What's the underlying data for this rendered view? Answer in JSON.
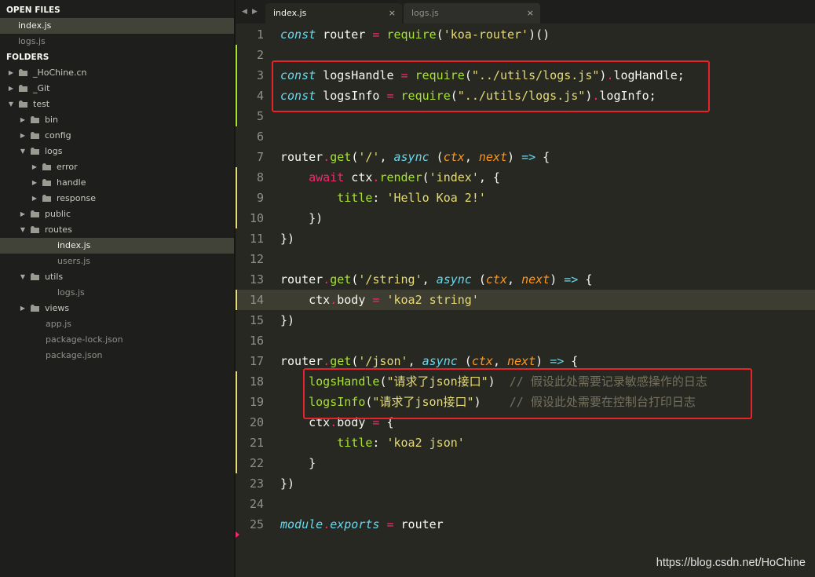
{
  "sidebar": {
    "open_files_header": "OPEN FILES",
    "open_files": [
      {
        "name": "index.js",
        "active": true
      },
      {
        "name": "logs.js",
        "active": false
      }
    ],
    "folders_header": "FOLDERS",
    "tree": [
      {
        "name": "_HoChine.cn",
        "type": "folder",
        "expanded": false,
        "depth": 0
      },
      {
        "name": "_Git",
        "type": "folder",
        "expanded": false,
        "depth": 0
      },
      {
        "name": "test",
        "type": "folder",
        "expanded": true,
        "depth": 0
      },
      {
        "name": "bin",
        "type": "folder",
        "expanded": false,
        "depth": 1
      },
      {
        "name": "config",
        "type": "folder",
        "expanded": false,
        "depth": 1
      },
      {
        "name": "logs",
        "type": "folder",
        "expanded": true,
        "depth": 1
      },
      {
        "name": "error",
        "type": "folder",
        "expanded": false,
        "depth": 2
      },
      {
        "name": "handle",
        "type": "folder",
        "expanded": false,
        "depth": 2
      },
      {
        "name": "response",
        "type": "folder",
        "expanded": false,
        "depth": 2
      },
      {
        "name": "public",
        "type": "folder",
        "expanded": false,
        "depth": 1
      },
      {
        "name": "routes",
        "type": "folder",
        "expanded": true,
        "depth": 1
      },
      {
        "name": "index.js",
        "type": "file",
        "active": true,
        "depth": 2
      },
      {
        "name": "users.js",
        "type": "file",
        "depth": 2
      },
      {
        "name": "utils",
        "type": "folder",
        "expanded": true,
        "depth": 1
      },
      {
        "name": "logs.js",
        "type": "file",
        "depth": 2
      },
      {
        "name": "views",
        "type": "folder",
        "expanded": false,
        "depth": 1
      },
      {
        "name": "app.js",
        "type": "file",
        "depth": 1
      },
      {
        "name": "package-lock.json",
        "type": "file",
        "depth": 1
      },
      {
        "name": "package.json",
        "type": "file",
        "depth": 1
      }
    ]
  },
  "tabs": [
    {
      "label": "index.js",
      "active": true,
      "close": "×"
    },
    {
      "label": "logs.js",
      "active": false,
      "close": "×"
    }
  ],
  "nav_arrows": {
    "left": "◀",
    "right": "▶"
  },
  "editor": {
    "current_line": 14,
    "lines": [
      {
        "n": "1",
        "mark": "",
        "tokens": [
          [
            "kw",
            "const"
          ],
          [
            "pl",
            " router "
          ],
          [
            "op",
            "="
          ],
          [
            "pl",
            " "
          ],
          [
            "fn",
            "require"
          ],
          [
            "pl",
            "("
          ],
          [
            "str",
            "'koa-router'"
          ],
          [
            "pl",
            ")()"
          ]
        ]
      },
      {
        "n": "2",
        "mark": "green",
        "tokens": []
      },
      {
        "n": "3",
        "mark": "green",
        "tokens": [
          [
            "kw",
            "const"
          ],
          [
            "pl",
            " logsHandle "
          ],
          [
            "op",
            "="
          ],
          [
            "pl",
            " "
          ],
          [
            "fn",
            "require"
          ],
          [
            "pl",
            "("
          ],
          [
            "str",
            "\"../utils/logs.js\""
          ],
          [
            "pl",
            ")"
          ],
          [
            "op",
            "."
          ],
          [
            "pl",
            "logHandle;"
          ]
        ]
      },
      {
        "n": "4",
        "mark": "green",
        "tokens": [
          [
            "kw",
            "const"
          ],
          [
            "pl",
            " logsInfo "
          ],
          [
            "op",
            "="
          ],
          [
            "pl",
            " "
          ],
          [
            "fn",
            "require"
          ],
          [
            "pl",
            "("
          ],
          [
            "str",
            "\"../utils/logs.js\""
          ],
          [
            "pl",
            ")"
          ],
          [
            "op",
            "."
          ],
          [
            "pl",
            "logInfo;"
          ]
        ]
      },
      {
        "n": "5",
        "mark": "green",
        "tokens": []
      },
      {
        "n": "6",
        "mark": "",
        "tokens": []
      },
      {
        "n": "7",
        "mark": "",
        "tokens": [
          [
            "pl",
            "router"
          ],
          [
            "op",
            "."
          ],
          [
            "fn",
            "get"
          ],
          [
            "pl",
            "("
          ],
          [
            "str",
            "'/'"
          ],
          [
            "pl",
            ", "
          ],
          [
            "kw",
            "async"
          ],
          [
            "pl",
            " ("
          ],
          [
            "param",
            "ctx"
          ],
          [
            "pl",
            ", "
          ],
          [
            "param",
            "next"
          ],
          [
            "pl",
            ") "
          ],
          [
            "kw2",
            "=>"
          ],
          [
            "pl",
            " {"
          ]
        ]
      },
      {
        "n": "8",
        "mark": "yellow",
        "tokens": [
          [
            "pl",
            "    "
          ],
          [
            "red",
            "await"
          ],
          [
            "pl",
            " ctx"
          ],
          [
            "op",
            "."
          ],
          [
            "fn",
            "render"
          ],
          [
            "pl",
            "("
          ],
          [
            "str",
            "'index'"
          ],
          [
            "pl",
            ", {"
          ]
        ]
      },
      {
        "n": "9",
        "mark": "yellow",
        "tokens": [
          [
            "pl",
            "        "
          ],
          [
            "fn",
            "title"
          ],
          [
            "pl",
            ": "
          ],
          [
            "str",
            "'Hello Koa 2!'"
          ]
        ]
      },
      {
        "n": "10",
        "mark": "yellow",
        "tokens": [
          [
            "pl",
            "    })"
          ]
        ]
      },
      {
        "n": "11",
        "mark": "",
        "tokens": [
          [
            "pl",
            "})"
          ]
        ]
      },
      {
        "n": "12",
        "mark": "",
        "tokens": []
      },
      {
        "n": "13",
        "mark": "",
        "tokens": [
          [
            "pl",
            "router"
          ],
          [
            "op",
            "."
          ],
          [
            "fn",
            "get"
          ],
          [
            "pl",
            "("
          ],
          [
            "str",
            "'/string'"
          ],
          [
            "pl",
            ", "
          ],
          [
            "kw",
            "async"
          ],
          [
            "pl",
            " ("
          ],
          [
            "param",
            "ctx"
          ],
          [
            "pl",
            ", "
          ],
          [
            "param",
            "next"
          ],
          [
            "pl",
            ") "
          ],
          [
            "kw2",
            "=>"
          ],
          [
            "pl",
            " {"
          ]
        ]
      },
      {
        "n": "14",
        "mark": "yellow",
        "tokens": [
          [
            "pl",
            "    ctx"
          ],
          [
            "op",
            "."
          ],
          [
            "pl",
            "body "
          ],
          [
            "op",
            "="
          ],
          [
            "pl",
            " "
          ],
          [
            "str",
            "'koa2 string'"
          ]
        ]
      },
      {
        "n": "15",
        "mark": "",
        "tokens": [
          [
            "pl",
            "})"
          ]
        ]
      },
      {
        "n": "16",
        "mark": "",
        "tokens": []
      },
      {
        "n": "17",
        "mark": "",
        "tokens": [
          [
            "pl",
            "router"
          ],
          [
            "op",
            "."
          ],
          [
            "fn",
            "get"
          ],
          [
            "pl",
            "("
          ],
          [
            "str",
            "'/json'"
          ],
          [
            "pl",
            ", "
          ],
          [
            "kw",
            "async"
          ],
          [
            "pl",
            " ("
          ],
          [
            "param",
            "ctx"
          ],
          [
            "pl",
            ", "
          ],
          [
            "param",
            "next"
          ],
          [
            "pl",
            ") "
          ],
          [
            "kw2",
            "=>"
          ],
          [
            "pl",
            " {"
          ]
        ]
      },
      {
        "n": "18",
        "mark": "yellow",
        "tokens": [
          [
            "pl",
            "    "
          ],
          [
            "fn",
            "logsHandle"
          ],
          [
            "pl",
            "("
          ],
          [
            "str",
            "\"请求了json接口\""
          ],
          [
            "pl",
            ")  "
          ],
          [
            "cm",
            "// 假设此处需要记录敏感操作的日志"
          ]
        ]
      },
      {
        "n": "19",
        "mark": "yellow",
        "tokens": [
          [
            "pl",
            "    "
          ],
          [
            "fn",
            "logsInfo"
          ],
          [
            "pl",
            "("
          ],
          [
            "str",
            "\"请求了json接口\""
          ],
          [
            "pl",
            ")    "
          ],
          [
            "cm",
            "// 假设此处需要在控制台打印日志"
          ]
        ]
      },
      {
        "n": "20",
        "mark": "yellow",
        "tokens": [
          [
            "pl",
            "    ctx"
          ],
          [
            "op",
            "."
          ],
          [
            "pl",
            "body "
          ],
          [
            "op",
            "="
          ],
          [
            "pl",
            " {"
          ]
        ]
      },
      {
        "n": "21",
        "mark": "yellow",
        "tokens": [
          [
            "pl",
            "        "
          ],
          [
            "fn",
            "title"
          ],
          [
            "pl",
            ": "
          ],
          [
            "str",
            "'koa2 json'"
          ]
        ]
      },
      {
        "n": "22",
        "mark": "yellow",
        "tokens": [
          [
            "pl",
            "    }"
          ]
        ]
      },
      {
        "n": "23",
        "mark": "",
        "tokens": [
          [
            "pl",
            "})"
          ]
        ]
      },
      {
        "n": "24",
        "mark": "",
        "tokens": []
      },
      {
        "n": "25",
        "mark": "",
        "tokens": [
          [
            "kw",
            "module"
          ],
          [
            "op",
            "."
          ],
          [
            "kw",
            "exports"
          ],
          [
            "pl",
            " "
          ],
          [
            "op",
            "="
          ],
          [
            "pl",
            " router"
          ]
        ]
      }
    ]
  },
  "watermark": "https://blog.csdn.net/HoChine",
  "colors": {
    "editor_bg": "#272822",
    "sidebar_bg": "#1e1f1c",
    "keyword": "#66d9ef",
    "function": "#a6e22e",
    "string": "#e6db74",
    "operator": "#f92672",
    "param": "#fd971f",
    "comment": "#75715e",
    "highlight_box": "#e8222a"
  }
}
